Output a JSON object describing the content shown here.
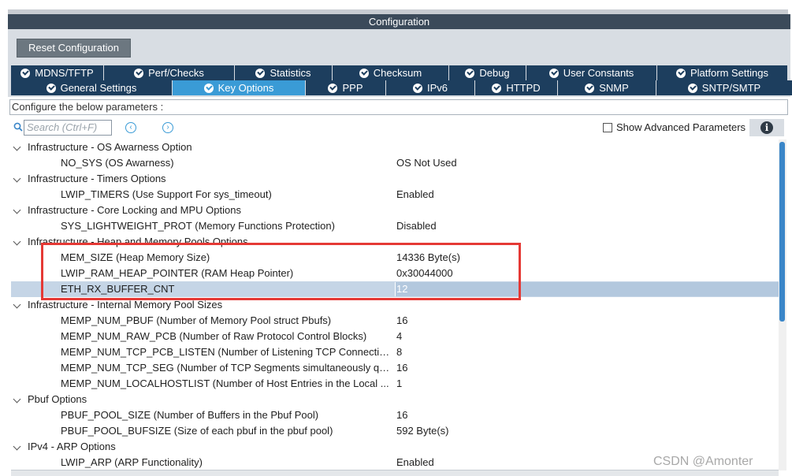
{
  "window": {
    "title": "Configuration"
  },
  "toolbar": {
    "reset_label": "Reset Configuration"
  },
  "tabs_row1": [
    {
      "label": "MDNS/TFTP",
      "active": false
    },
    {
      "label": "Perf/Checks",
      "active": false
    },
    {
      "label": "Statistics",
      "active": false
    },
    {
      "label": "Checksum",
      "active": false
    },
    {
      "label": "Debug",
      "active": false
    },
    {
      "label": "User Constants",
      "active": false
    },
    {
      "label": "Platform Settings",
      "active": false
    }
  ],
  "tabs_row2": [
    {
      "label": "General Settings",
      "active": false
    },
    {
      "label": "Key Options",
      "active": true
    },
    {
      "label": "PPP",
      "active": false
    },
    {
      "label": "IPv6",
      "active": false
    },
    {
      "label": "HTTPD",
      "active": false
    },
    {
      "label": "SNMP",
      "active": false
    },
    {
      "label": "SNTP/SMTP",
      "active": false
    }
  ],
  "configure_label": "Configure the below parameters :",
  "search": {
    "placeholder": "Search (Ctrl+F)"
  },
  "advanced": {
    "label": "Show Advanced Parameters",
    "checked": false
  },
  "tree": [
    {
      "kind": "group",
      "label": "Infrastructure - OS Awarness Option"
    },
    {
      "kind": "param",
      "name": "NO_SYS (OS Awarness)",
      "value": "OS Not Used"
    },
    {
      "kind": "group",
      "label": "Infrastructure - Timers Options"
    },
    {
      "kind": "param",
      "name": "LWIP_TIMERS (Use Support For sys_timeout)",
      "value": "Enabled"
    },
    {
      "kind": "group",
      "label": "Infrastructure - Core Locking and MPU Options"
    },
    {
      "kind": "param",
      "name": "SYS_LIGHTWEIGHT_PROT (Memory Functions Protection)",
      "value": "Disabled"
    },
    {
      "kind": "group",
      "label": "Infrastructure - Heap and Memory Pools Options"
    },
    {
      "kind": "param",
      "name": "MEM_SIZE (Heap Memory Size)",
      "value": "14336 Byte(s)"
    },
    {
      "kind": "param",
      "name": "LWIP_RAM_HEAP_POINTER (RAM Heap Pointer)",
      "value": "0x30044000"
    },
    {
      "kind": "param",
      "name": "ETH_RX_BUFFER_CNT",
      "value": "12",
      "selected": true
    },
    {
      "kind": "group",
      "label": "Infrastructure - Internal Memory Pool Sizes"
    },
    {
      "kind": "param",
      "name": "MEMP_NUM_PBUF (Number of Memory Pool struct Pbufs)",
      "value": "16"
    },
    {
      "kind": "param",
      "name": "MEMP_NUM_RAW_PCB (Number of Raw Protocol Control Blocks)",
      "value": "4"
    },
    {
      "kind": "param",
      "name": "MEMP_NUM_TCP_PCB_LISTEN (Number of Listening TCP Connectio...",
      "value": "8"
    },
    {
      "kind": "param",
      "name": "MEMP_NUM_TCP_SEG (Number of TCP Segments simultaneously qu...",
      "value": "16"
    },
    {
      "kind": "param",
      "name": "MEMP_NUM_LOCALHOSTLIST (Number of Host Entries in the Local ...",
      "value": "1"
    },
    {
      "kind": "group",
      "label": "Pbuf Options"
    },
    {
      "kind": "param",
      "name": "PBUF_POOL_SIZE (Number of Buffers in the Pbuf Pool)",
      "value": "16"
    },
    {
      "kind": "param",
      "name": "PBUF_POOL_BUFSIZE (Size of each pbuf in the pbuf pool)",
      "value": "592 Byte(s)"
    },
    {
      "kind": "group",
      "label": "IPv4 - ARP Options"
    },
    {
      "kind": "param",
      "name": "LWIP_ARP (ARP Functionality)",
      "value": "Enabled"
    }
  ],
  "watermark": "CSDN @Amonter",
  "colors": {
    "title_bar": "#3b4a5a",
    "tab_inactive": "#1d3e5e",
    "tab_active": "#3a9bd6",
    "selection": "#c5d5e6",
    "highlight_box": "#e53935"
  }
}
